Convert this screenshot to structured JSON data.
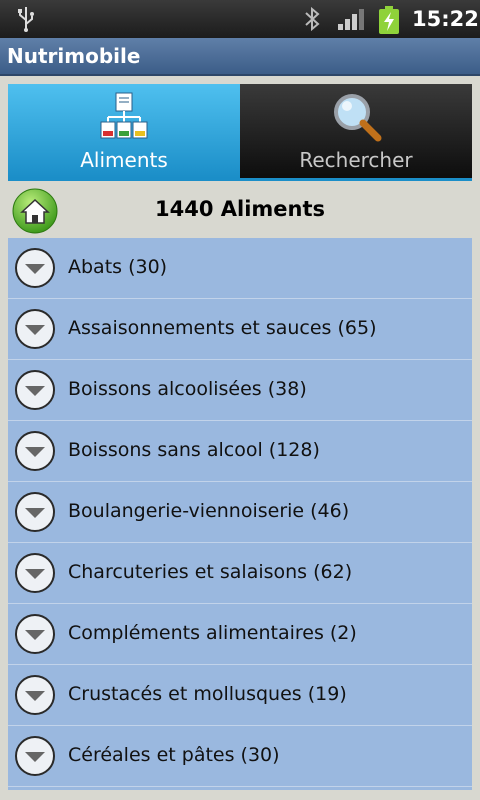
{
  "status_bar": {
    "time": "15:22"
  },
  "app": {
    "title": "Nutrimobile"
  },
  "tabs": [
    {
      "label": "Aliments",
      "icon": "food-hierarchy-icon"
    },
    {
      "label": "Rechercher",
      "icon": "magnifier-icon"
    }
  ],
  "header": {
    "title": "1440 Aliments",
    "home_icon": "home-icon"
  },
  "colors": {
    "accent": "#1b8ec8",
    "list_bg": "#9ab8df",
    "home_green": "#5cb82e"
  },
  "categories": [
    {
      "label": "Abats (30)"
    },
    {
      "label": "Assaisonnements et sauces (65)"
    },
    {
      "label": "Boissons alcoolisées (38)"
    },
    {
      "label": "Boissons sans alcool (128)"
    },
    {
      "label": "Boulangerie-viennoiserie (46)"
    },
    {
      "label": "Charcuteries et salaisons (62)"
    },
    {
      "label": "Compléments alimentaires (2)"
    },
    {
      "label": "Crustacés et mollusques (19)"
    },
    {
      "label": "Céréales et pâtes (30)"
    }
  ]
}
